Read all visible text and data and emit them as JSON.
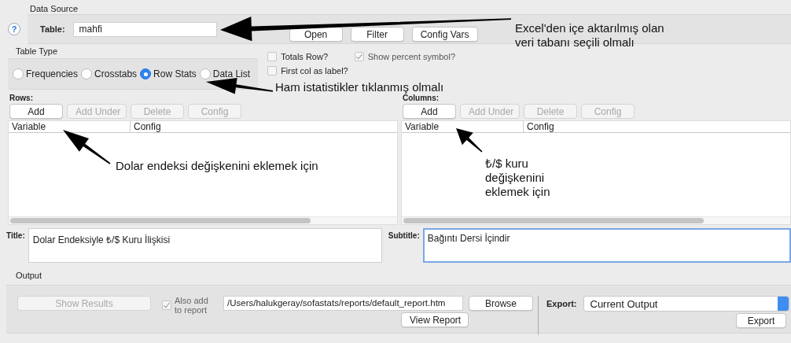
{
  "data_source": {
    "label": "Data Source",
    "help": "?",
    "table_label": "Table:",
    "table_value": "mahfi",
    "buttons": [
      "Open",
      "Filter",
      "Config Vars"
    ]
  },
  "table_type": {
    "label": "Table Type",
    "options": [
      {
        "label": "Frequencies",
        "selected": false
      },
      {
        "label": "Crosstabs",
        "selected": false
      },
      {
        "label": "Row Stats",
        "selected": true
      },
      {
        "label": "Data List",
        "selected": false
      }
    ]
  },
  "options": [
    {
      "label": "Totals Row?",
      "checked": false,
      "disabled": false
    },
    {
      "label": "Show percent symbol?",
      "checked": true,
      "disabled": true
    },
    {
      "label": "First col as label?",
      "checked": false,
      "disabled": false
    }
  ],
  "rows": {
    "label": "Rows:",
    "buttons": [
      {
        "label": "Add",
        "disabled": false
      },
      {
        "label": "Add Under",
        "disabled": true
      },
      {
        "label": "Delete",
        "disabled": true
      },
      {
        "label": "Config",
        "disabled": true
      }
    ],
    "headers": [
      "Variable",
      "Config"
    ]
  },
  "columns": {
    "label": "Columns:",
    "buttons": [
      {
        "label": "Add",
        "disabled": false
      },
      {
        "label": "Add Under",
        "disabled": true
      },
      {
        "label": "Delete",
        "disabled": true
      },
      {
        "label": "Config",
        "disabled": true
      }
    ],
    "headers": [
      "Variable",
      "Config"
    ]
  },
  "title": {
    "label": "Title:",
    "value": "Dolar Endeksiyle ₺/$ Kuru İlişkisi",
    "focused": false
  },
  "subtitle": {
    "label": "Subtitle:",
    "value": "Bağıntı Dersi İçindir",
    "focused": true
  },
  "output": {
    "label": "Output",
    "show_results": {
      "label": "Show Results",
      "disabled": true
    },
    "also_add": {
      "label": "Also add to report",
      "checked": true,
      "disabled": true
    },
    "report_path": "/Users/halukgeray/sofastats/reports/default_report.htm",
    "browse": "Browse",
    "view_report": "View Report",
    "export_label": "Export:",
    "export_value": "Current Output",
    "export_button": "Export"
  },
  "annotations": [
    {
      "lines": [
        "Excel'den içe aktarılmış olan",
        "veri tabanı seçili olmalı"
      ]
    },
    {
      "lines": [
        "Ham istatistikler tıklanmış olmalı"
      ]
    },
    {
      "lines": [
        "Dolar endeksi değişkenini eklemek için"
      ]
    },
    {
      "lines": [
        "₺/$ kuru",
        "değişkenini",
        "eklemek için"
      ]
    }
  ]
}
